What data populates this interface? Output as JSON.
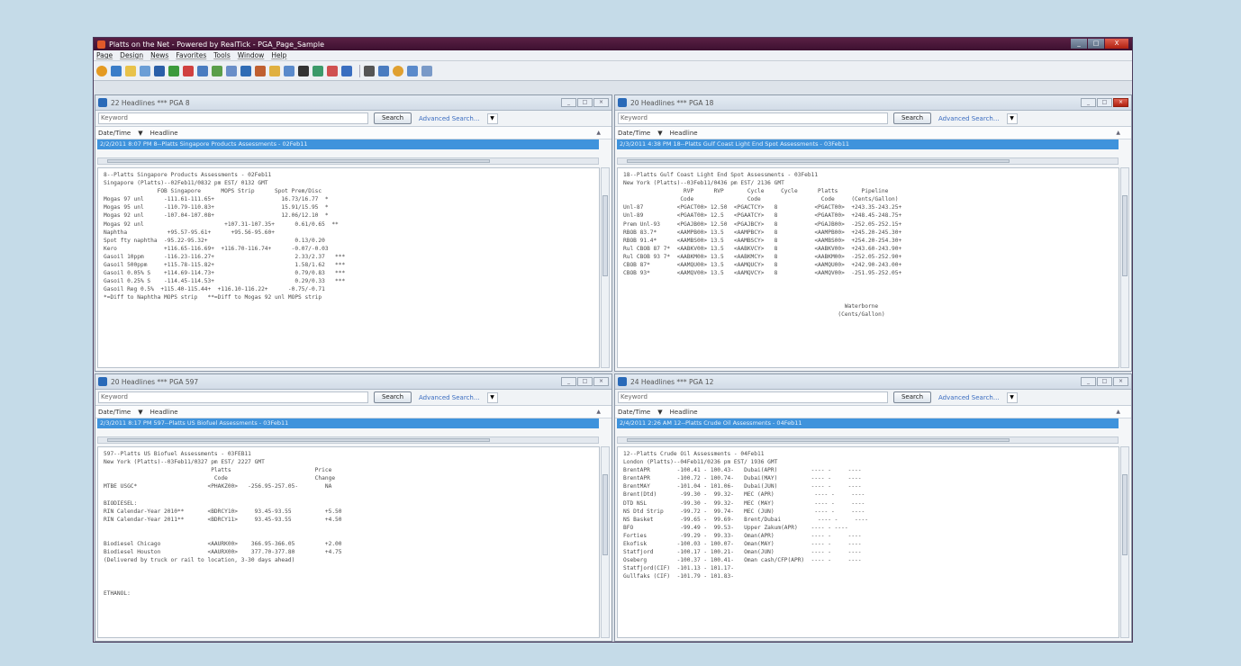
{
  "window": {
    "title": "Platts on the Net - Powered by RealTick - PGA_Page_Sample",
    "controls": [
      "_",
      "□",
      "X"
    ]
  },
  "menu": [
    "Page",
    "Design",
    "News",
    "Favorites",
    "Tools",
    "Window",
    "Help"
  ],
  "toolbar_icons": [
    "open-icon",
    "save-icon",
    "folder-icon",
    "page-icon",
    "pen-icon",
    "chart-icon",
    "grid-icon",
    "news-icon",
    "quote-icon",
    "link-icon",
    "table-icon",
    "window-icon",
    "monitor-icon",
    "dash-icon",
    "color-icon",
    "draw-icon",
    "refresh-icon",
    "binoculars-icon",
    "print-icon",
    "help-icon",
    "alert-icon",
    "tile-icon",
    "font-icon"
  ],
  "panes": {
    "tl": {
      "title": "22 Headlines *** PGA 8",
      "keyword": "Keyword",
      "search": "Search",
      "advanced": "Advanced Search...",
      "col_datetime": "Date/Time",
      "col_headline": "Headline",
      "selected": "2/2/2011 8:07 PM   8--Platts Singapore Products Assessments - 02Feb11",
      "text": "8--Platts Singapore Products Assessments - 02Feb11\nSingapore (Platts)--02Feb11/0832 pm EST/ 0132 GMT\n                FOB Singapore      MOPS Strip      Spot Prem/Disc\nMogas 97 unl      -111.61-111.65+                    16.73/16.77  *\nMogas 95 unl      -110.79-110.83+                    15.91/15.95  *\nMogas 92 unl      -107.04-107.08+                    12.06/12.10  *\nMogas 92 unl                        +107.31-107.35+      0.61/0.65  **\nNaphtha            +95.57-95.61+      +95.56-95.60+\nSpot fty naphtha  -95.22-95.32+                          0.13/0.20\nKero              +116.65-116.69+  +116.70-116.74+      -0.07/-0.03\nGasoil 10ppm      -116.23-116.27+                        2.33/2.37   ***\nGasoil 500ppm     +115.78-115.82+                        1.58/1.62   ***\nGasoil 0.05% S    +114.69-114.73+                        0.79/0.83   ***\nGasoil 0.25% S    -114.45-114.53+                        0.29/0.33   ***\nGasoil Reg 0.5%  +115.40-115.44+  +116.10-116.22+      -0.75/-0.71\n*=Diff to Naphtha MOPS strip   **=Diff to Mogas 92 unl MOPS strip"
    },
    "tr": {
      "title": "20 Headlines *** PGA 18",
      "keyword": "Keyword",
      "search": "Search",
      "advanced": "Advanced Search...",
      "col_datetime": "Date/Time",
      "col_headline": "Headline",
      "selected": "2/3/2011 4:38 PM   18--Platts Gulf Coast Light End Spot Assessments - 03Feb11",
      "text": "18--Platts Gulf Coast Light End Spot Assessments - 03Feb11\nNew York (Platts)--03Feb11/0436 pm EST/ 2136 GMT\n                  RVP      RVP       Cycle     Cycle      Platts       Pipeline\n                 Code                Code                  Code     (Cents/Gallon)\nUnl-87          <PGACT00> 12.50  <PGACTCY>   8           <PGACT00>  +243.35-243.25+\nUnl-89          <PGAAT00> 12.5   <PGAATCY>   8           <PGAAT00>  +248.45-248.75+\nPrem Unl-93     <PGAJB00> 12.50  <PGAJBCY>   8           <PGAJB00>  -252.05-252.15+\nRBOB 83.7*      <AAMPB00> 13.5   <AAMPBCY>   8           <AAMPB00>  +245.20-245.30+\nRBOB 91.4*      <AAMBS00> 13.5   <AAMBSCY>   8           <AAMBS00>  +254.20-254.30+\nRul CBOB 87 7*  <AABKV00> 13.5   <AABKVCY>   8           <AABKV00>  +243.60-243.90+\nRul CBOB 93 7*  <AABKM00> 13.5   <AABKMCY>   8           <AABKM00>  -252.05-252.90+\nCBOB 87*        <AAMQU00> 13.5   <AAMQUCY>   8           <AAMQU00>  +242.90-243.00+\nCBOB 93*        <AAMQV00> 13.5   <AAMQVCY>   8           <AAMQV00>  -251.95-252.05+\n\n\n\n                                                                  Waterborne\n                                                                (Cents/Gallon)"
    },
    "bl": {
      "title": "20 Headlines *** PGA 597",
      "keyword": "Keyword",
      "search": "Search",
      "advanced": "Advanced Search...",
      "col_datetime": "Date/Time",
      "col_headline": "Headline",
      "selected": "2/3/2011 8:17 PM   597--Platts US Biofuel Assessments - 03Feb11",
      "text": "597--Platts US Biofuel Assessments - 03FEB11\nNew York (Platts)--03Feb11/0327 pm EST/ 2227 GMT\n                                Platts                         Price\n                                 Code                          Change\nMTBE USGC*                     <PHAKZ00>   -256.95-257.05-        NA\n\nBIODIESEL:\nRIN Calendar-Year 2010**       <BDRCY10>     93.45-93.55          +5.50\nRIN Calendar-Year 2011**       <BDRCY11>     93.45-93.55          +4.50\n\n\nBiodiesel Chicago              <AAURK00>    366.95-366.05         +2.00\nBiodiesel Houston              <AAURX00>    377.70-377.80         +4.75\n(Delivered by truck or rail to location, 3-30 days ahead)\n\n\n\nETHANOL:"
    },
    "br": {
      "title": "24 Headlines *** PGA 12",
      "keyword": "Keyword",
      "search": "Search",
      "advanced": "Advanced Search...",
      "col_datetime": "Date/Time",
      "col_headline": "Headline",
      "selected": "2/4/2011 2:26 AM   12--Platts Crude Oil Assessments - 04Feb11",
      "text": "12--Platts Crude Oil Assessments - 04Feb11\nLondon (Platts)--04Feb11/0236 pm EST/ 1936 GMT\nBrentAPR        -100.41 - 100.43-   Dubai(APR)          ---- -     ----\nBrentAPR        -100.72 - 100.74-   Dubai(MAY)          ---- -     ----\nBrentMAY        -101.04 - 101.06-   Dubai(JUN)          ---- -     ----\nBrent(Dtd)       -99.30 -  99.32-   MEC (APR)            ---- -     ----\nDTD NSL          -99.30 -  99.32-   MEC (MAY)            ---- -     ----\nNS Dtd Strip     -99.72 -  99.74-   MEC (JUN)            ---- -     ----\nNS Basket        -99.65 -  99.69-   Brent/Dubai           ---- -     ----\nBFO              -99.49 -  99.53-   Upper Zakum(APR)    ---- - ----\nForties          -99.29 -  99.33-   Oman(APR)           ---- -     ----\nEkofisk         -100.03 - 100.07-   Oman(MAY)           ---- -     ----\nStatfjord       -100.17 - 100.21-   Oman(JUN)           ---- -     ----\nOseberg         -100.37 - 100.41-   Oman cash/CFP(APR)  ---- -     ----\nStatfjord(CIF)  -101.13 - 101.17-\nGullfaks (CIF)  -101.79 - 101.83-"
    }
  }
}
